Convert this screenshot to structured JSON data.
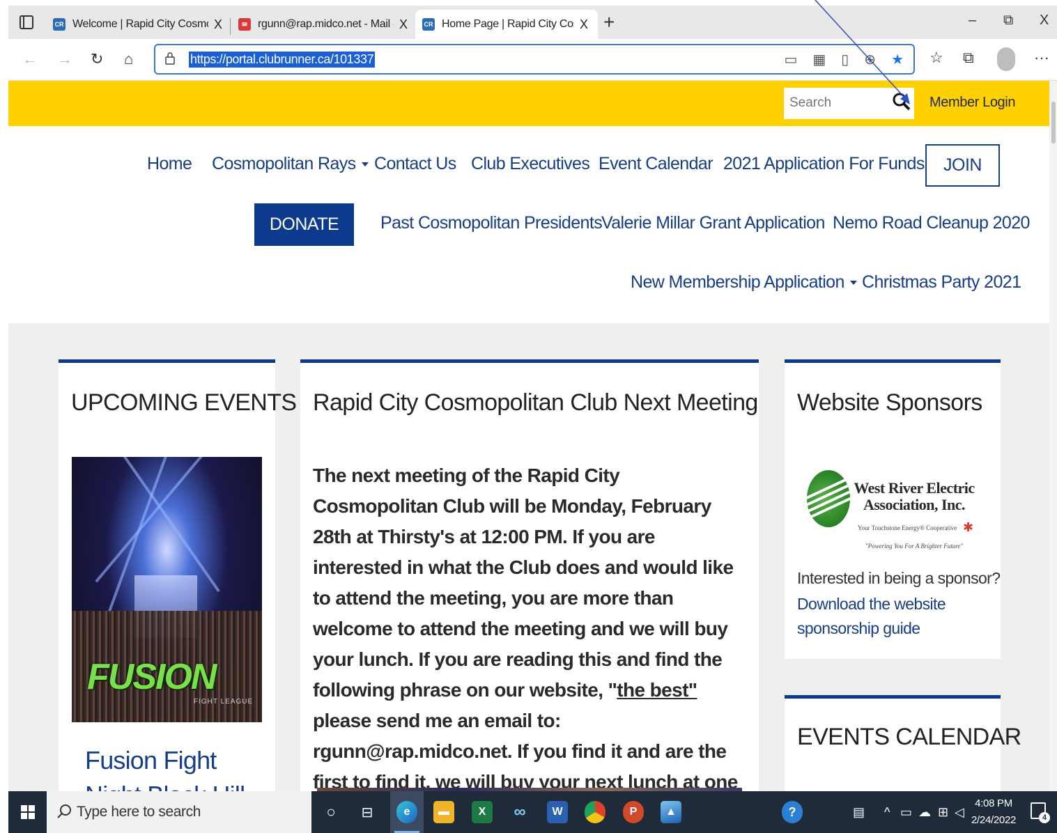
{
  "browser": {
    "tabs": [
      {
        "favicon": "CR",
        "title": "Welcome | Rapid City Cosmopolitan",
        "close": "X"
      },
      {
        "favicon": "mail-icon",
        "title": "rgunn@rap.midco.net - Mail - Microsoft",
        "close": "X"
      },
      {
        "favicon": "CR",
        "title": "Home Page | Rapid City Cosmopolitan",
        "close": "X",
        "active": true
      }
    ],
    "new_tab": "+",
    "window_controls": {
      "minimize": "–",
      "restore": "⧉",
      "close": "X"
    },
    "url": "https://portal.clubrunner.ca/101337"
  },
  "site": {
    "search_placeholder": "Search",
    "member_login": "Member Login",
    "nav_row1": [
      {
        "label": "Home"
      },
      {
        "label": "Cosmopolitan Rays",
        "dropdown": true
      },
      {
        "label": "Contact Us"
      },
      {
        "label": "Club Executives"
      },
      {
        "label": "Event Calendar"
      },
      {
        "label": "2021 Application For Funds"
      }
    ],
    "join": "JOIN",
    "donate": "DONATE",
    "nav_row2": [
      {
        "label": "Past Cosmopolitan Presidents"
      },
      {
        "label": "Valerie Millar Grant Application"
      },
      {
        "label": "Nemo Road Cleanup 2020"
      }
    ],
    "nav_row3": [
      {
        "label": "New Membership Application",
        "dropdown": true
      },
      {
        "label": "Christmas Party 2021"
      }
    ],
    "colors": {
      "accent_yellow": "#ffd100",
      "brand_navy": "#0c3a8c",
      "link_blue": "#163d85"
    }
  },
  "events": {
    "heading": "UPCOMING EVENTS",
    "image_logo_text": "FUSION",
    "image_subtext": "FIGHT LEAGUE",
    "event_title_line1": "Fusion Fight",
    "event_title_line2": "Night Black Hill"
  },
  "meeting": {
    "heading": "Rapid City Cosmopolitan Club Next Meeting",
    "body_before_link": " The next meeting of the Rapid City Cosmopolitan Club will be Monday, February 28th at Thirsty's at 12:00 PM. If you are interested in what the Club does and would like to attend the meeting, you are more than welcome to attend the meeting and we will buy your lunch. If you are reading this and find the following phrase on our website, \"",
    "link_text": "the best\"",
    "body_after_link": " please send me an email to: rgunn@rap.midco.net. If you find it and are the first to find it, we will buy your next lunch at one of our meetings at Thirsty's"
  },
  "sponsors": {
    "heading": "Website Sponsors",
    "logo_name": "West River Electric Association, Inc.",
    "logo_tagline": "Your Touchstone Energy® Cooperative",
    "logo_slogan": "\"Powering You For A Brighter Future\"",
    "question": "Interested in being a sponsor?",
    "link_line1": "Download the website",
    "link_line2": "sponsorship guide"
  },
  "calendar": {
    "heading": "EVENTS CALENDAR"
  },
  "taskbar": {
    "search_placeholder": "Type here to search",
    "apps": [
      "cortana-icon",
      "task-view-icon",
      "edge-icon",
      "file-explorer-icon",
      "excel-icon",
      "infinity-icon",
      "word-icon",
      "chrome-icon",
      "powerpoint-icon",
      "photos-icon"
    ],
    "time": "4:08 PM",
    "date": "2/24/2022",
    "notification_count": "4"
  }
}
